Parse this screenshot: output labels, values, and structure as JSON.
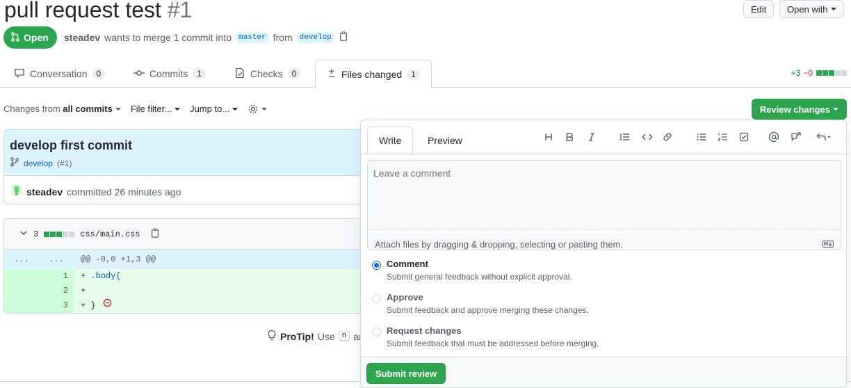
{
  "header": {
    "title": "pull request test",
    "number": "#1",
    "edit_label": "Edit",
    "open_with_label": "Open with"
  },
  "status": {
    "badge_label": "Open",
    "author": "steadev",
    "merge_text": "wants to merge 1 commit into",
    "base_branch": "master",
    "from_text": "from",
    "head_branch": "develop"
  },
  "tabs": [
    {
      "label": "Conversation",
      "count": "0"
    },
    {
      "label": "Commits",
      "count": "1"
    },
    {
      "label": "Checks",
      "count": "0"
    },
    {
      "label": "Files changed",
      "count": "1"
    }
  ],
  "diffstat": {
    "additions": "+3",
    "deletions": "−0"
  },
  "toolbar": {
    "changes_from_prefix": "Changes from",
    "changes_from_value": "all commits",
    "file_filter": "File filter...",
    "jump_to": "Jump to..."
  },
  "review_button_label": "Review changes",
  "commit": {
    "title": "develop first commit",
    "branch": "develop",
    "pr_ref": "(#1)",
    "author": "steadev",
    "committed_text": "committed 26 minutes ago"
  },
  "file": {
    "change_count": "3",
    "path": "css/main.css",
    "hunk_left": "...",
    "hunk_right": "...",
    "hunk_header": "@@ -0,0 +1,3 @@",
    "lines": [
      {
        "num": "1",
        "prefix": "+ ",
        "code": ".body{"
      },
      {
        "num": "2",
        "prefix": "+",
        "code": ""
      },
      {
        "num": "3",
        "prefix": "+ ",
        "code": "}"
      }
    ]
  },
  "protip": {
    "label": "ProTip!",
    "text_before": "Use",
    "key": "n",
    "text_after": "and"
  },
  "review_popover": {
    "write_tab": "Write",
    "preview_tab": "Preview",
    "comment_placeholder": "Leave a comment",
    "attach_text": "Attach files by dragging & dropping, selecting or pasting them.",
    "options": [
      {
        "title": "Comment",
        "desc": "Submit general feedback without explicit approval.",
        "selected": true
      },
      {
        "title": "Approve",
        "desc": "Submit feedback and approve merging these changes.",
        "selected": false
      },
      {
        "title": "Request changes",
        "desc": "Submit feedback that must be addressed before merging.",
        "selected": false
      }
    ],
    "submit_label": "Submit review"
  },
  "colors": {
    "green": "#2da44e",
    "blue": "#0969da",
    "diff_add": "#e6ffec",
    "hunk": "#ddf4ff"
  }
}
